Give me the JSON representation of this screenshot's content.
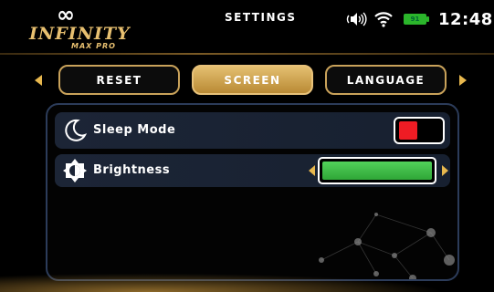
{
  "header": {
    "logo_symbol": "∞",
    "logo_brand": "INFINITY",
    "logo_sub": "MAX PRO",
    "title": "SETTINGS",
    "battery_level": "91",
    "time": "12:48"
  },
  "tabs": [
    {
      "label": "RESET",
      "active": false
    },
    {
      "label": "SCREEN",
      "active": true
    },
    {
      "label": "LANGUAGE",
      "active": false
    }
  ],
  "settings": {
    "sleep_mode": {
      "label": "Sleep Mode",
      "enabled": false
    },
    "brightness": {
      "label": "Brightness",
      "level": 1.0
    }
  },
  "colors": {
    "accent": "#c9a25a",
    "toggle_off": "#ee1c24",
    "brightness_fill": "#3cba44",
    "row_bg": "#1c2536"
  },
  "icons": {
    "sound": "speaker-icon",
    "wifi": "wifi-icon",
    "battery": "battery-icon",
    "sleep": "moon-icon",
    "brightness": "brightness-icon"
  }
}
